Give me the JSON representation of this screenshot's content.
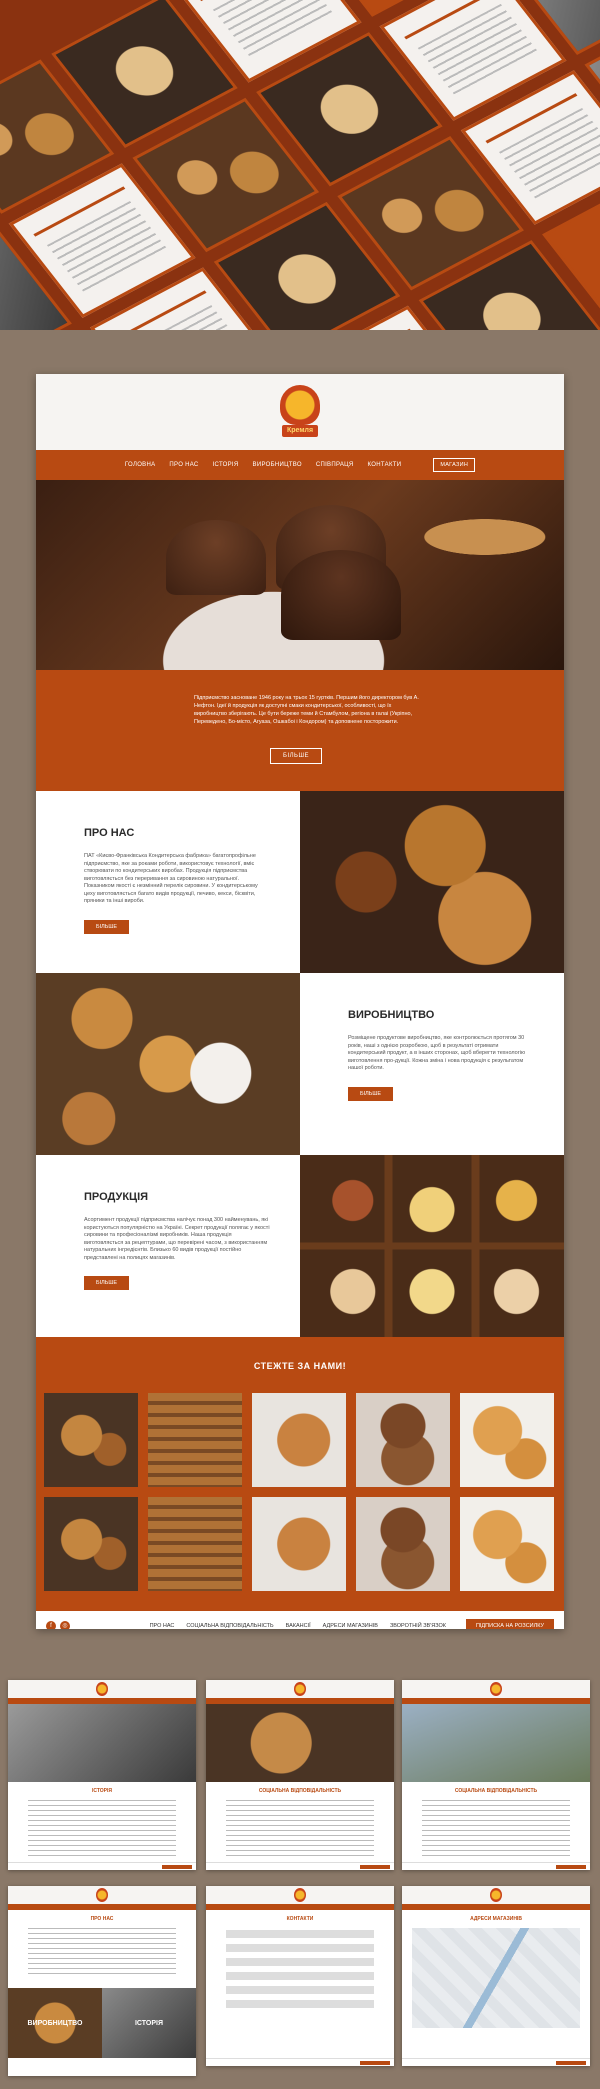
{
  "brand": {
    "logo_text": "Кремля",
    "accent": "#b84a12"
  },
  "nav": {
    "items": [
      "ГОЛОВНА",
      "ПРО НАС",
      "ІСТОРІЯ",
      "ВИРОБНИЦТВО",
      "СПІВПРАЦЯ",
      "КОНТАКТИ"
    ],
    "shop_label": "МАГАЗИН"
  },
  "intro": {
    "text": "Підприємство засноване 1946 року на трьох 15 гуртків. Першим його директором був А. Нефтон. Ідеї й продукція як доступні смаки кондитерської, особливості, що їх виробництво зберігають. Це бути береже теми й Стамбулом, регіона в галаі (Укріпно, Переведено, Бо-місто, Агуаза, Ошкабоі і Кондором) та доповнене посторожити.",
    "button": "БІЛЬШЕ"
  },
  "about": {
    "title": "ПРО НАС",
    "text": "ПАТ «Києво-Франківська Кондитерська фабрика» багатопрофільне підприємство, яке за роками роботи, використовує технології, вміє створювати по кондитерських виробах. Продукція підприємства виготовляється без переривання за сировиною натуральної. Показником якості є незмінний перелік сировини. У кондитерському цеху виготовляється багато видів продукції, печиво, кекси, бісквіти, пряники та інші вироби.",
    "button": "БІЛЬШЕ"
  },
  "production": {
    "title": "ВИРОБНИЦТВО",
    "text": "Розміщене продуктове виробництво, яке контролюється протягом 30 років, наші з однією розробкою, щоб в результаті отримати кондитерський продукт, а в інших сторонах, щоб вберегти технологію виготовлення про-дукції. Кожна зміна і нова продукція є результатом нашої роботи.",
    "button": "БІЛЬШЕ"
  },
  "products": {
    "title": "ПРОДУКЦІЯ",
    "text": "Асортимент продукції підприємства налічує понад 300 найменувань, які користуються популярністю на Україні. Секрет продукції полягає у якості сировини та професіоналізмі виробників. Наша продукція виготовляється за рецептурами, що перевірені часом, з використанням натуральних інгредієнтів. Близько 60 видів продукції постійно представлені на полицях магазинів.",
    "button": "БІЛЬШЕ"
  },
  "follow": {
    "title": "СТЕЖТЕ ЗА НАМИ!"
  },
  "footer": {
    "links": [
      "ПРО НАС",
      "СОЦІАЛЬНА ВІДПОВІДАЛЬНІСТЬ",
      "ВАКАНСІЇ",
      "АДРЕСИ МАГАЗИНІВ",
      "ЗВОРОТНІЙ ЗВ'ЯЗОК"
    ],
    "subscribe": "ПІДПИСКА НА РОЗСИЛКУ",
    "social_icons": [
      "facebook-icon",
      "instagram-icon"
    ]
  },
  "thumbs": [
    {
      "title": "ІСТОРІЯ"
    },
    {
      "title": "СОЦІАЛЬНА ВІДПОВІДАЛЬНІСТЬ"
    },
    {
      "title": "СОЦІАЛЬНА ВІДПОВІДАЛЬНІСТЬ"
    },
    {
      "title": "ПРО НАС"
    },
    {
      "title": "КОНТАКТИ"
    },
    {
      "title": "АДРЕСИ МАГАЗИНІВ"
    }
  ],
  "thumb_bottom_labels": [
    "ВИРОБНИЦТВО",
    "ІСТОРІЯ"
  ]
}
